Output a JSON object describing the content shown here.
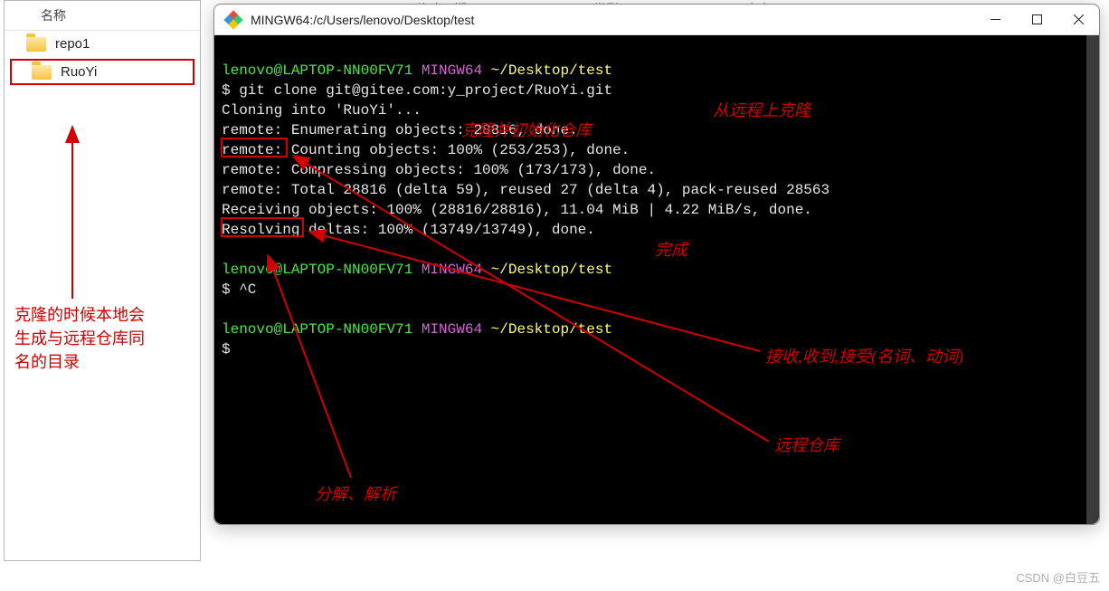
{
  "explorer": {
    "col_name": "名称",
    "items": [
      {
        "label": "repo1"
      },
      {
        "label": "RuoYi"
      }
    ]
  },
  "header_cols": {
    "modified": "修改日期",
    "type": "类型",
    "size": "大小"
  },
  "terminal": {
    "title": "MINGW64:/c/Users/lenovo/Desktop/test",
    "prompt_user": "lenovo@LAPTOP-NN00FV71",
    "prompt_shell": "MINGW64",
    "prompt_path": "~/Desktop/test",
    "cmd_clone": "$ git clone git@gitee.com:y_project/RuoYi.git",
    "out_cloning": "Cloning into 'RuoYi'...",
    "out_remote_enum": "remote: Enumerating objects: 28816, done.",
    "out_remote_count": "remote: Counting objects: 100% (253/253), done.",
    "out_remote_compress": "remote: Compressing objects: 100% (173/173), done.",
    "out_remote_total": "remote: Total 28816 (delta 59), reused 27 (delta 4), pack-reused 28563",
    "out_receiving": "Receiving objects: 100% (28816/28816), 11.04 MiB | 4.22 MiB/s, done.",
    "out_resolving": "Resolving deltas: 100% (13749/13749), done.",
    "cancel": "$ ^C",
    "prompt_dollar": "$ "
  },
  "annotations": {
    "clone_from_remote": "从远程上克隆",
    "clone_init_repo": "克隆并初始化仓库",
    "done": "完成",
    "local_dir_note": "克隆的时候本地会\n生成与远程仓库同\n名的目录",
    "receiving_meaning": "接收,收到,接受(名词、动词)",
    "remote_repo": "远程仓库",
    "resolve_meaning": "分解、解析"
  },
  "watermark": "CSDN @白豆五"
}
